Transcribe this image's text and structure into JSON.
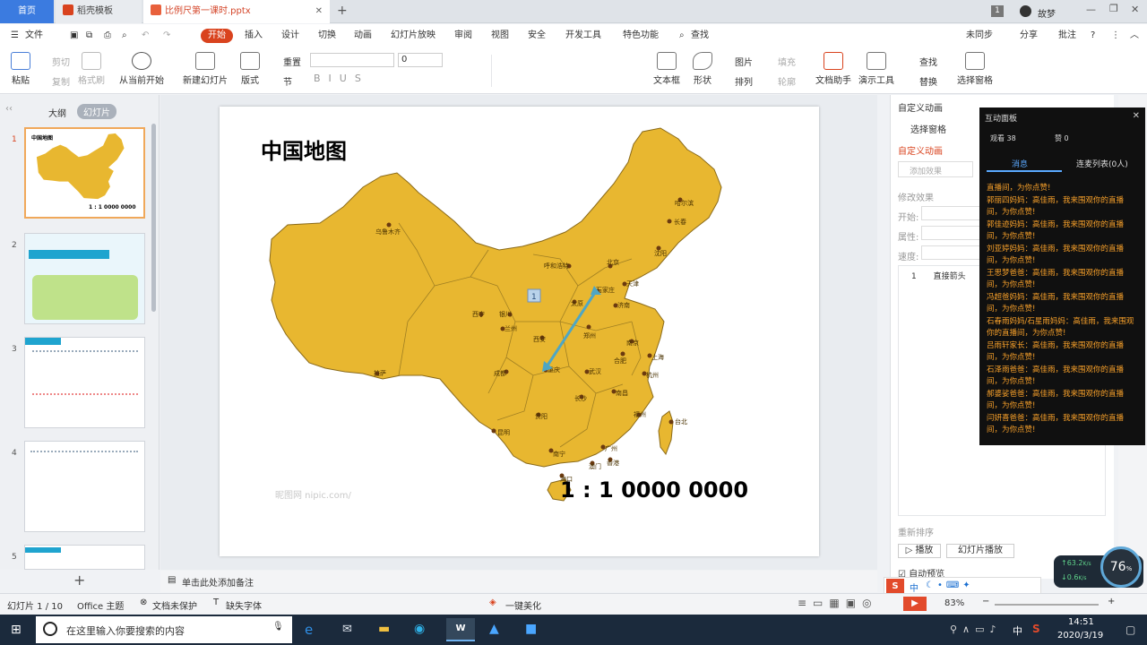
{
  "tabs": {
    "home": "首页",
    "template": "稻壳模板",
    "doc": "比例尺第一课时.pptx"
  },
  "titlebar": {
    "user": "故梦",
    "page_count": "1"
  },
  "menu": {
    "file": "文件",
    "items": [
      "开始",
      "插入",
      "设计",
      "切换",
      "动画",
      "幻灯片放映",
      "审阅",
      "视图",
      "安全",
      "开发工具",
      "特色功能"
    ],
    "search": "查找",
    "sync": "未同步",
    "share": "分享",
    "comment": "批注"
  },
  "ribbon": {
    "paste": "粘贴",
    "cut": "剪切",
    "copy": "复制",
    "format_painter": "格式刷",
    "from_current": "从当前开始",
    "new_slide": "新建幻灯片",
    "layout": "版式",
    "section": "节",
    "reset": "重置",
    "font_size": "0",
    "textbox": "文本框",
    "shape": "形状",
    "arrange": "排列",
    "picture": "图片",
    "fill": "填充",
    "outline": "轮廓",
    "doc_helper": "文档助手",
    "present_tool": "演示工具",
    "find": "查找",
    "replace": "替换",
    "select_pane": "选择窗格"
  },
  "leftpane": {
    "outline_tab": "大纲",
    "slides_tab": "幻灯片",
    "slide_numbers": [
      "1",
      "2",
      "3",
      "4",
      "5"
    ]
  },
  "slide": {
    "title": "中国地图",
    "scale": "1 : 1 0000 0000",
    "watermark": "昵图网 nipic.com/",
    "tag": "1",
    "cities": [
      "乌鲁木齐",
      "哈尔滨",
      "长春",
      "沈阳",
      "呼和浩特",
      "北京",
      "天津",
      "石家庄",
      "太原",
      "济南",
      "银川",
      "兰州",
      "西宁",
      "西安",
      "郑州",
      "南京",
      "合肥",
      "上海",
      "拉萨",
      "成都",
      "重庆",
      "武汉",
      "杭州",
      "长沙",
      "南昌",
      "福州",
      "贵阳",
      "昆明",
      "南宁",
      "广州",
      "台北",
      "香港",
      "澳门",
      "海口"
    ]
  },
  "notes": {
    "placeholder": "单击此处添加备注"
  },
  "anim_pane": {
    "title": "自定义动画",
    "select_pane": "选择窗格",
    "custom_anim": "自定义动画",
    "add_effect": "添加效果",
    "modify": "修改效果",
    "start": "开始:",
    "property": "属性:",
    "speed": "速度:",
    "item": "直接箭头",
    "reorder": "重新排序",
    "play": "播放",
    "slideshow": "幻灯片播放",
    "autopreview": "自动预览"
  },
  "panel": {
    "title": "互动面板",
    "viewers": "观看 38",
    "likes": "赞 0",
    "tab_msg": "消息",
    "tab_mic": "连麦列表(0人)",
    "messages": [
      "直播间，为你点赞!",
      "郭丽四妈妈：高佳雨，我来围观你的直播间，为你点赞!",
      "郭佳迹妈妈：高佳雨，我来围观你的直播间，为你点赞!",
      "刘亚婷妈妈：高佳雨，我来围观你的直播间，为你点赞!",
      "王思梦爸爸：高佳雨，我来围观你的直播间，为你点赞!",
      "冯超爸妈妈：高佳雨，我来围观你的直播间，为你点赞!",
      "石春雨妈妈/石星雨妈妈：高佳雨，我来围观你的直播间，为你点赞!",
      "吕雨轩家长：高佳雨，我来围观你的直播间，为你点赞!",
      "石泽雨爸爸：高佳雨，我来围观你的直播间，为你点赞!",
      "郝婆娑爸爸：高佳雨，我来围观你的直播间，为你点赞!",
      "闫妍喜爸爸：高佳雨，我来围观你的直播间，为你点赞!"
    ]
  },
  "status": {
    "slide_info": "幻灯片 1 / 10",
    "theme": "Office 主题",
    "protect": "文档未保护",
    "missing_font": "缺失字体",
    "beautify": "一键美化",
    "zoom": "83%"
  },
  "net": {
    "up": "63.2",
    "down": "0.6",
    "unit": "K/s",
    "cpu": "76",
    "cpu_unit": "%"
  },
  "taskbar": {
    "search_placeholder": "在这里输入你要搜索的内容",
    "time": "14:51",
    "date": "2020/3/19",
    "ime": "中"
  },
  "colors": {
    "accent": "#d9431e",
    "map_fill": "#e8b730",
    "map_stroke": "#8a6a1a",
    "arrow": "#4ea6c4",
    "panel_bg": "#101010",
    "panel_text": "#f7a02a"
  }
}
